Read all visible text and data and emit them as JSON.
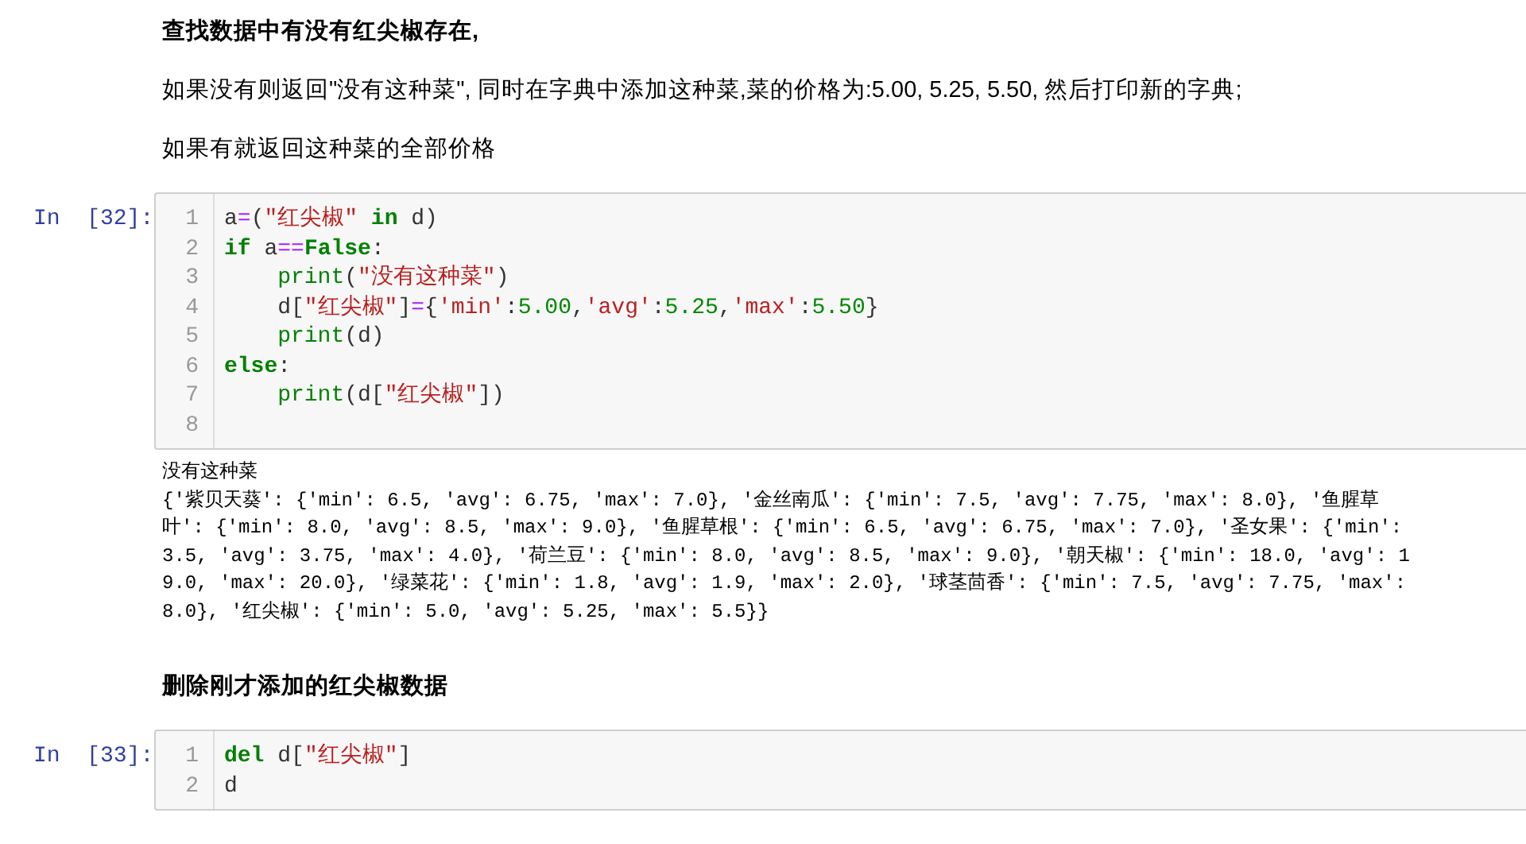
{
  "cells": [
    {
      "kind": "markdown",
      "paragraphs": [
        {
          "text": "查找数据中有没有红尖椒存在,",
          "bold": true
        },
        {
          "text": "如果没有则返回\"没有这种菜\", 同时在字典中添加这种菜,菜的价格为:5.00, 5.25, 5.50, 然后打印新的字典;",
          "bold": false
        },
        {
          "text": "如果有就返回这种菜的全部价格",
          "bold": false
        }
      ]
    },
    {
      "kind": "code",
      "prompt": "In  [32]:",
      "lines": [
        {
          "number": "1",
          "tokens": [
            {
              "kind": "plain",
              "text": "a"
            },
            {
              "kind": "op",
              "text": "="
            },
            {
              "kind": "plain",
              "text": "("
            },
            {
              "kind": "string",
              "text": "\"红尖椒\""
            },
            {
              "kind": "keyword",
              "text": " in"
            },
            {
              "kind": "plain",
              "text": " d)"
            }
          ]
        },
        {
          "number": "2",
          "tokens": [
            {
              "kind": "keyword",
              "text": "if"
            },
            {
              "kind": "plain",
              "text": " a"
            },
            {
              "kind": "op",
              "text": "=="
            },
            {
              "kind": "keyword",
              "text": "False"
            },
            {
              "kind": "plain",
              "text": ":"
            }
          ]
        },
        {
          "number": "3",
          "indent": true,
          "tokens": [
            {
              "kind": "builtin",
              "text": "print"
            },
            {
              "kind": "plain",
              "text": "("
            },
            {
              "kind": "string",
              "text": "\"没有这种菜\""
            },
            {
              "kind": "plain",
              "text": ")"
            }
          ]
        },
        {
          "number": "4",
          "indent": true,
          "tokens": [
            {
              "kind": "plain",
              "text": "d["
            },
            {
              "kind": "string",
              "text": "\"红尖椒\""
            },
            {
              "kind": "plain",
              "text": "]"
            },
            {
              "kind": "op",
              "text": "="
            },
            {
              "kind": "plain",
              "text": "{"
            },
            {
              "kind": "string",
              "text": "'min'"
            },
            {
              "kind": "plain",
              "text": ":"
            },
            {
              "kind": "number",
              "text": "5.00"
            },
            {
              "kind": "plain",
              "text": ","
            },
            {
              "kind": "string",
              "text": "'avg'"
            },
            {
              "kind": "plain",
              "text": ":"
            },
            {
              "kind": "number",
              "text": "5.25"
            },
            {
              "kind": "plain",
              "text": ","
            },
            {
              "kind": "string",
              "text": "'max'"
            },
            {
              "kind": "plain",
              "text": ":"
            },
            {
              "kind": "number",
              "text": "5.50"
            },
            {
              "kind": "plain",
              "text": "}"
            }
          ]
        },
        {
          "number": "5",
          "indent": true,
          "tokens": [
            {
              "kind": "builtin",
              "text": "print"
            },
            {
              "kind": "plain",
              "text": "(d)"
            }
          ]
        },
        {
          "number": "6",
          "tokens": [
            {
              "kind": "keyword",
              "text": "else"
            },
            {
              "kind": "plain",
              "text": ":"
            }
          ]
        },
        {
          "number": "7",
          "indent": true,
          "tokens": [
            {
              "kind": "builtin",
              "text": "print"
            },
            {
              "kind": "plain",
              "text": "(d["
            },
            {
              "kind": "string",
              "text": "\"红尖椒\""
            },
            {
              "kind": "plain",
              "text": "])"
            }
          ]
        },
        {
          "number": "8"
        }
      ],
      "output": [
        "没有这种菜",
        "{'紫贝天葵': {'min': 6.5, 'avg': 6.75, 'max': 7.0}, '金丝南瓜': {'min': 7.5, 'avg': 7.75, 'max': 8.0}, '鱼腥草",
        "叶': {'min': 8.0, 'avg': 8.5, 'max': 9.0}, '鱼腥草根': {'min': 6.5, 'avg': 6.75, 'max': 7.0}, '圣女果': {'min':",
        "3.5, 'avg': 3.75, 'max': 4.0}, '荷兰豆': {'min': 8.0, 'avg': 8.5, 'max': 9.0}, '朝天椒': {'min': 18.0, 'avg': 1",
        "9.0, 'max': 20.0}, '绿菜花': {'min': 1.8, 'avg': 1.9, 'max': 2.0}, '球茎茴香': {'min': 7.5, 'avg': 7.75, 'max':",
        "8.0}, '红尖椒': {'min': 5.0, 'avg': 5.25, 'max': 5.5}}"
      ]
    },
    {
      "kind": "markdown",
      "paragraphs": [
        {
          "text": "删除刚才添加的红尖椒数据",
          "bold": true
        }
      ]
    },
    {
      "kind": "code",
      "prompt": "In  [33]:",
      "lines": [
        {
          "number": "1",
          "tokens": [
            {
              "kind": "keyword",
              "text": "del"
            },
            {
              "kind": "plain",
              "text": " d["
            },
            {
              "kind": "string",
              "text": "\"红尖椒\""
            },
            {
              "kind": "plain",
              "text": "]"
            }
          ]
        },
        {
          "number": "2",
          "tokens": [
            {
              "kind": "plain",
              "text": "d"
            }
          ]
        }
      ]
    }
  ]
}
